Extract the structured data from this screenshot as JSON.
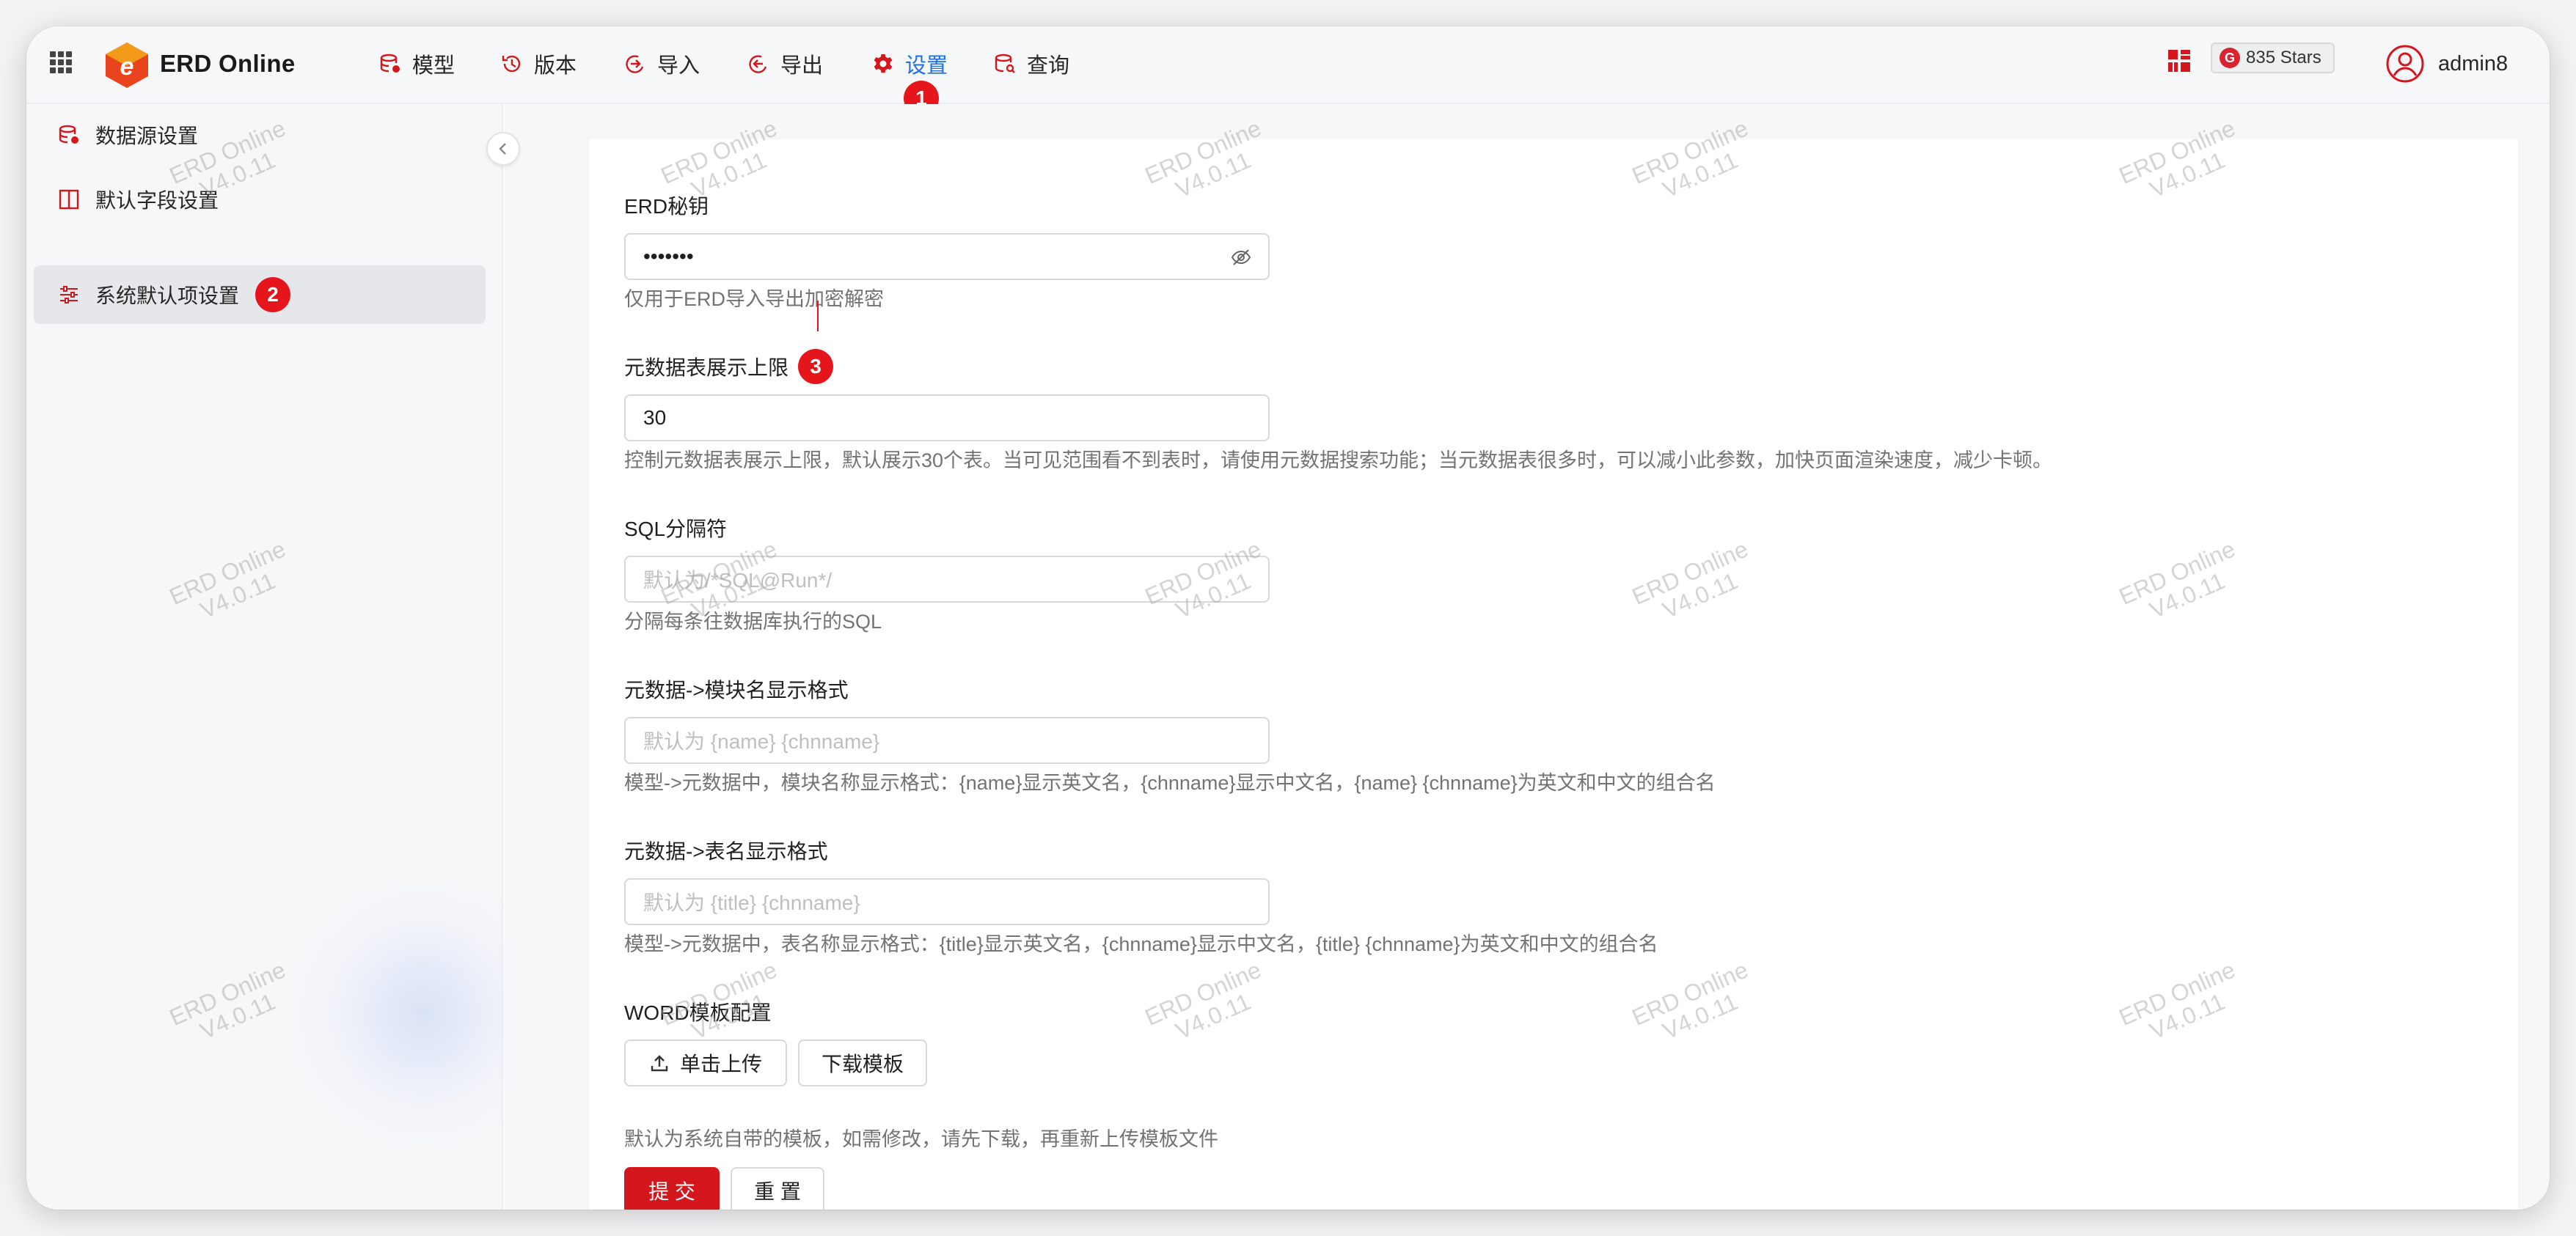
{
  "app": {
    "title": "ERD Online"
  },
  "header": {
    "nav": [
      {
        "label": "模型",
        "icon": "database-icon"
      },
      {
        "label": "版本",
        "icon": "history-icon"
      },
      {
        "label": "导入",
        "icon": "import-icon"
      },
      {
        "label": "导出",
        "icon": "export-icon"
      },
      {
        "label": "设置",
        "icon": "gear-icon",
        "active": true
      },
      {
        "label": "查询",
        "icon": "query-icon"
      }
    ],
    "stars": "835 Stars",
    "stars_badge": "G",
    "user": "admin8"
  },
  "annotations": {
    "one": "1",
    "two": "2",
    "three": "3"
  },
  "sidebar": {
    "items": [
      {
        "label": "数据源设置",
        "icon": "datasource-icon"
      },
      {
        "label": "默认字段设置",
        "icon": "columns-icon"
      },
      {
        "label": "系统默认项设置",
        "icon": "sliders-icon",
        "selected": true
      }
    ]
  },
  "form": {
    "secret": {
      "label": "ERD秘钥",
      "value": "•••••••",
      "help": "仅用于ERD导入导出加密解密"
    },
    "meta_limit": {
      "label": "元数据表展示上限",
      "value": "30",
      "help": "控制元数据表展示上限，默认展示30个表。当可见范围看不到表时，请使用元数据搜索功能；当元数据表很多时，可以减小此参数，加快页面渲染速度，减少卡顿。"
    },
    "sql_sep": {
      "label": "SQL分隔符",
      "placeholder": "默认为/*SQL@Run*/",
      "help": "分隔每条往数据库执行的SQL"
    },
    "module_format": {
      "label": "元数据->模块名显示格式",
      "placeholder": "默认为 {name} {chnname}",
      "help": "模型->元数据中，模块名称显示格式：{name}显示英文名，{chnname}显示中文名，{name} {chnname}为英文和中文的组合名"
    },
    "table_format": {
      "label": "元数据->表名显示格式",
      "placeholder": "默认为 {title} {chnname}",
      "help": "模型->元数据中，表名称显示格式：{title}显示英文名，{chnname}显示中文名，{title} {chnname}为英文和中文的组合名"
    },
    "word_template": {
      "label": "WORD模板配置",
      "upload": "单击上传",
      "download": "下载模板",
      "help": "默认为系统自带的模板，如需修改，请先下载，再重新上传模板文件"
    },
    "submit": "提 交",
    "reset": "重 置"
  },
  "watermark": {
    "line1": "ERD Online",
    "line2": "V4.0.11"
  },
  "colors": {
    "accent": "#1f6feb",
    "brand_red": "#d4161d",
    "badge_red": "#e6151c"
  }
}
